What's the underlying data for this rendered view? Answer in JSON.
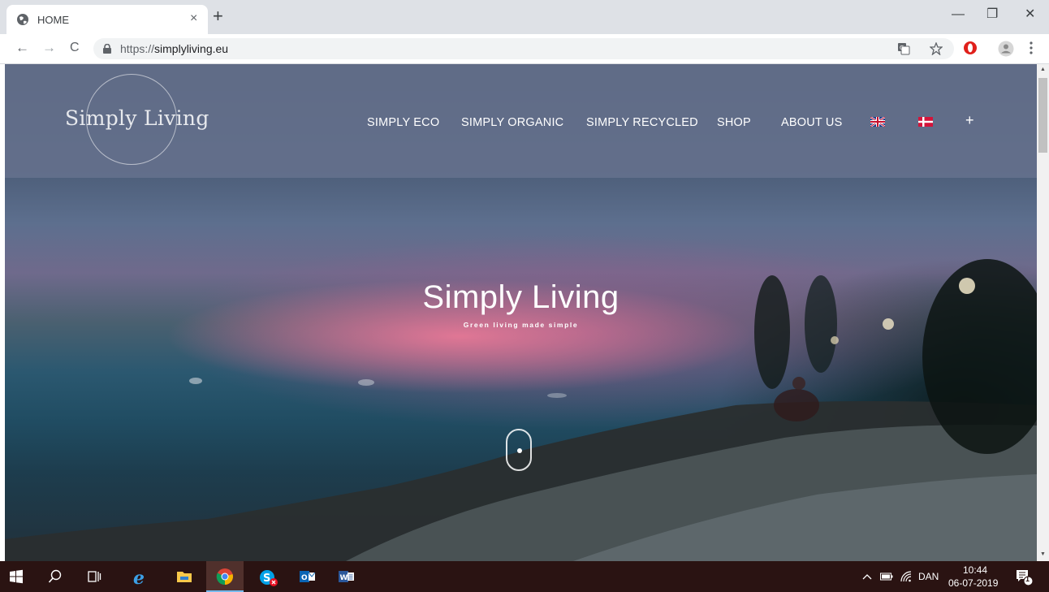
{
  "browser": {
    "tab_title": "HOME",
    "tab_close": "×",
    "new_tab": "+",
    "url_scheme": "https://",
    "url_host": "simplyliving.eu",
    "back": "←",
    "forward": "→",
    "reload": "C",
    "minimize": "—",
    "restore": "❐",
    "close": "✕"
  },
  "site": {
    "logo_text": "Simply Living",
    "menu": [
      {
        "label": "SIMPLY ECO"
      },
      {
        "label": "SIMPLY ORGANIC"
      },
      {
        "label": "SIMPLY RECYCLED"
      },
      {
        "label": "SHOP"
      },
      {
        "label": "ABOUT US"
      }
    ],
    "more": "+",
    "hero_title": "Simply Living",
    "hero_subtitle": "Green living made simple"
  },
  "taskbar": {
    "language": "DAN",
    "time": "10:44",
    "date": "06-07-2019",
    "notification_count": "1"
  },
  "colors": {
    "header_overlay": "#64708c",
    "taskbar": "#2a1312",
    "tab_bar": "#dee1e6"
  }
}
